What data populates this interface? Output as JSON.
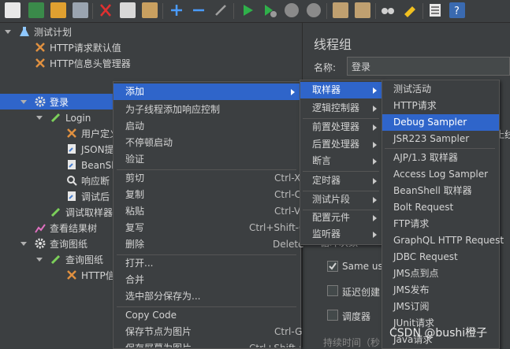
{
  "tree": {
    "items": [
      {
        "label": "测试计划",
        "icon": "test-plan-icon"
      },
      {
        "label": "HTTP请求默认值",
        "icon": "wrench-icon"
      },
      {
        "label": "HTTP信息头管理器",
        "icon": "wrench-icon"
      },
      {
        "label": "登录",
        "icon": "gear-icon"
      },
      {
        "label": "Login",
        "icon": "pen-icon"
      },
      {
        "label": "用户定义",
        "icon": "wrench-icon"
      },
      {
        "label": "JSON提",
        "icon": "document-icon"
      },
      {
        "label": "BeanSh",
        "icon": "document-icon"
      },
      {
        "label": "响应断",
        "icon": "search-icon"
      },
      {
        "label": "调试后",
        "icon": "document-icon"
      },
      {
        "label": "调试取样器",
        "icon": "pen-icon"
      },
      {
        "label": "查看结果树",
        "icon": "chart-icon"
      },
      {
        "label": "查询图纸",
        "icon": "gear-icon"
      },
      {
        "label": "查询图纸",
        "icon": "pen-icon"
      },
      {
        "label": "HTTP信",
        "icon": "wrench-icon"
      }
    ]
  },
  "right": {
    "title": "线程组",
    "name_label": "名称:",
    "name_value": "登录",
    "partial_right": "止线",
    "loop_label": "循环次数",
    "same_user": "Same use",
    "delay": "延迟创建",
    "scheduler": "调度器",
    "duration": "持续时间（秒"
  },
  "context_menu": {
    "items": [
      {
        "label": "添加",
        "shortcut": ""
      },
      {
        "label": "为子线程添加响应控制",
        "shortcut": ""
      },
      {
        "label": "启动",
        "shortcut": ""
      },
      {
        "label": "不停顿启动",
        "shortcut": ""
      },
      {
        "label": "验证",
        "shortcut": ""
      },
      {
        "label": "剪切",
        "shortcut": "Ctrl-X"
      },
      {
        "label": "复制",
        "shortcut": "Ctrl-C"
      },
      {
        "label": "粘贴",
        "shortcut": "Ctrl-V"
      },
      {
        "label": "复写",
        "shortcut": "Ctrl+Shift-C"
      },
      {
        "label": "删除",
        "shortcut": "Delete"
      },
      {
        "label": "打开...",
        "shortcut": ""
      },
      {
        "label": "合并",
        "shortcut": ""
      },
      {
        "label": "选中部分保存为...",
        "shortcut": ""
      },
      {
        "label": "Copy Code",
        "shortcut": ""
      },
      {
        "label": "保存节点为图片",
        "shortcut": "Ctrl-G"
      },
      {
        "label": "保存屏幕为图片",
        "shortcut": "Ctrl+Shift-G"
      }
    ]
  },
  "add_submenu": {
    "items": [
      "取样器",
      "逻辑控制器",
      "前置处理器",
      "后置处理器",
      "断言",
      "定时器",
      "测试片段",
      "配置元件",
      "监听器"
    ]
  },
  "sampler_submenu": {
    "items": [
      "测试活动",
      "HTTP请求",
      "Debug Sampler",
      "JSR223 Sampler",
      "AJP/1.3 取样器",
      "Access Log Sampler",
      "BeanShell 取样器",
      "Bolt Request",
      "FTP请求",
      "GraphQL HTTP Request",
      "JDBC Request",
      "JMS点到点",
      "JMS发布",
      "JMS订阅",
      "JUnit请求",
      "Java请求"
    ]
  },
  "watermark": "CSDN @bushi橙子"
}
